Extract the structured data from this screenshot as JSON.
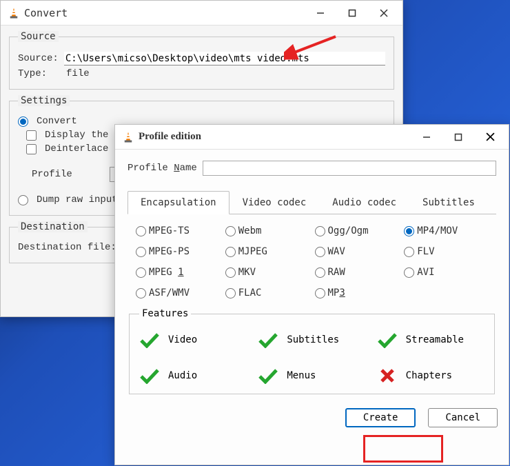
{
  "convert": {
    "title": "Convert",
    "source_group": "Source",
    "source_label": "Source:",
    "source_value": "C:\\Users\\micso\\Desktop\\video\\mts video.mts",
    "type_label": "Type:",
    "type_value": "file",
    "settings_group": "Settings",
    "convert_radio": "Convert",
    "display_check": "Display the ou",
    "deinterlace_check": "Deinterlace",
    "profile_label": "Profile",
    "dump_radio": "Dump raw input",
    "destination_group": "Destination",
    "destination_label": "Destination file:"
  },
  "profile": {
    "title": "Profile edition",
    "name_label_pre": "Profile ",
    "name_label_u": "N",
    "name_label_post": "ame",
    "name_value": "",
    "tabs": [
      "Encapsulation",
      "Video codec",
      "Audio codec",
      "Subtitles"
    ],
    "formats": {
      "r0": [
        "MPEG-TS",
        "Webm",
        "Ogg/Ogm",
        "MP4/MOV"
      ],
      "r1": [
        "MPEG-PS",
        "MJPEG",
        "WAV",
        "FLV"
      ],
      "r2_pre": "MPEG ",
      "r2_u": "1",
      "r2": [
        "",
        "MKV",
        "RAW",
        "AVI"
      ],
      "r3": [
        "ASF/WMV",
        "FLAC",
        "",
        ""
      ],
      "mp3_pre": "MP",
      "mp3_u": "3"
    },
    "selected_format": "MP4/MOV",
    "features_group": "Features",
    "features": {
      "video": "Video",
      "subtitles": "Subtitles",
      "streamable": "Streamable",
      "audio": "Audio",
      "menus": "Menus",
      "chapters": "Chapters"
    },
    "create_btn": "Create",
    "cancel_btn": "Cancel"
  },
  "colors": {
    "accent": "#0067c0",
    "highlight": "#e52323",
    "check_green": "#25a62f",
    "cross_red": "#d62222"
  }
}
